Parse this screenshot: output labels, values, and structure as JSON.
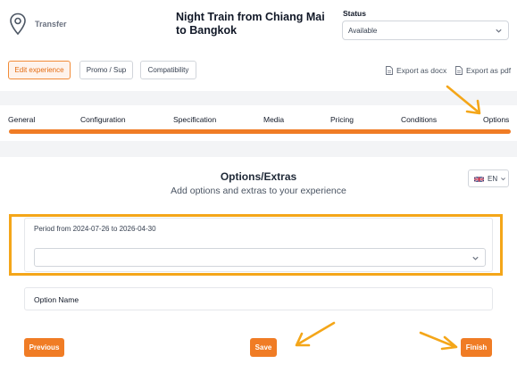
{
  "header": {
    "category": "Transfer",
    "title": "Night Train from Chiang Mai to Bangkok",
    "status_label": "Status",
    "status_value": "Available"
  },
  "toolbar": {
    "edit_experience": "Edit experience",
    "promo_sup": "Promo / Sup",
    "compatibility": "Compatibility",
    "export_docx": "Export as docx",
    "export_pdf": "Export as pdf"
  },
  "tabs": [
    {
      "label": "General"
    },
    {
      "label": "Configuration"
    },
    {
      "label": "Specification"
    },
    {
      "label": "Media"
    },
    {
      "label": "Pricing"
    },
    {
      "label": "Conditions"
    },
    {
      "label": "Options"
    }
  ],
  "progress": {
    "percent": 100,
    "color": "#f07c25"
  },
  "section": {
    "title": "Options/Extras",
    "subtitle": "Add options and extras to your experience"
  },
  "language": {
    "code": "EN",
    "flag": "uk-flag-icon"
  },
  "period": {
    "label": "Period from 2024-07-26 to 2026-04-30",
    "select_value": ""
  },
  "option": {
    "label": "Option Name"
  },
  "buttons": {
    "previous": "Previous",
    "save": "Save",
    "finish": "Finish"
  },
  "colors": {
    "accent": "#f07c25",
    "highlight": "#f4a619",
    "arrow": "#f4a619"
  }
}
